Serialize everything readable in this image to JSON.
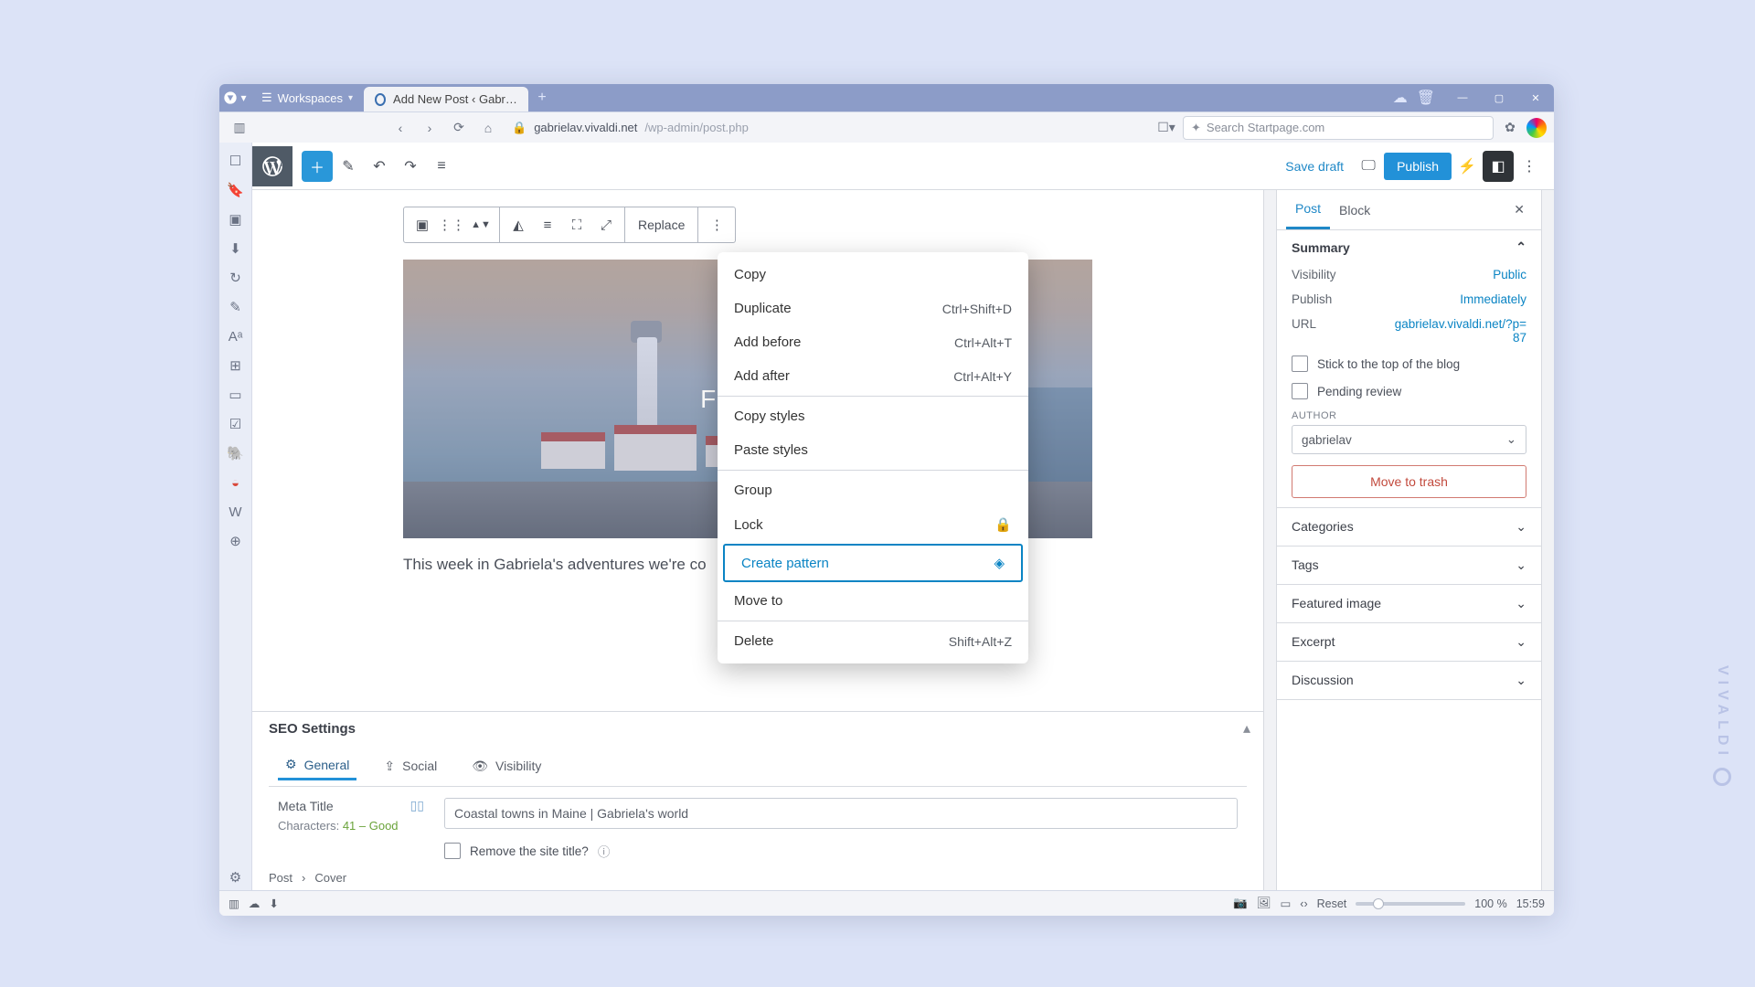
{
  "titlebar": {
    "workspaces_label": "Workspaces",
    "tab_title": "Add New Post ‹ Gabriela's …"
  },
  "addressbar": {
    "host": "gabrielav.vivaldi.net",
    "path": "/wp-admin/post.php",
    "search_placeholder": "Search Startpage.com"
  },
  "wp_topbar": {
    "save_draft": "Save draft",
    "publish": "Publish"
  },
  "block_toolbar": {
    "replace": "Replace"
  },
  "cover": {
    "title": "FAL"
  },
  "paragraph": "This week in Gabriela's adventures we're co",
  "context_menu": {
    "copy": "Copy",
    "duplicate": {
      "label": "Duplicate",
      "kb": "Ctrl+Shift+D"
    },
    "add_before": {
      "label": "Add before",
      "kb": "Ctrl+Alt+T"
    },
    "add_after": {
      "label": "Add after",
      "kb": "Ctrl+Alt+Y"
    },
    "copy_styles": "Copy styles",
    "paste_styles": "Paste styles",
    "group": "Group",
    "lock": "Lock",
    "create_pattern": "Create pattern",
    "move_to": "Move to",
    "delete": {
      "label": "Delete",
      "kb": "Shift+Alt+Z"
    }
  },
  "seo": {
    "heading": "SEO Settings",
    "tabs": {
      "general": "General",
      "social": "Social",
      "visibility": "Visibility"
    },
    "meta_title_label": "Meta Title",
    "meta_title_value": "Coastal towns in Maine | Gabriela's world",
    "chars_label": "Characters: ",
    "chars_value": "41 – Good",
    "remove_sitetitle": "Remove the site title?"
  },
  "breadcrumbs": {
    "a": "Post",
    "b": "Cover"
  },
  "settings": {
    "tabs": {
      "post": "Post",
      "block": "Block"
    },
    "summary": {
      "heading": "Summary",
      "visibility": {
        "label": "Visibility",
        "value": "Public"
      },
      "publish": {
        "label": "Publish",
        "value": "Immediately"
      },
      "url": {
        "label": "URL",
        "value": "gabrielav.vivaldi.net/?p=87"
      },
      "sticky": "Stick to the top of the blog",
      "pending": "Pending review",
      "author_label": "AUTHOR",
      "author_value": "gabrielav",
      "trash": "Move to trash"
    },
    "accordions": {
      "categories": "Categories",
      "tags": "Tags",
      "featured": "Featured image",
      "excerpt": "Excerpt",
      "discussion": "Discussion"
    }
  },
  "statusbar": {
    "reset": "Reset",
    "zoom": "100 %",
    "time": "15:59"
  },
  "watermark": "VIVALDI"
}
